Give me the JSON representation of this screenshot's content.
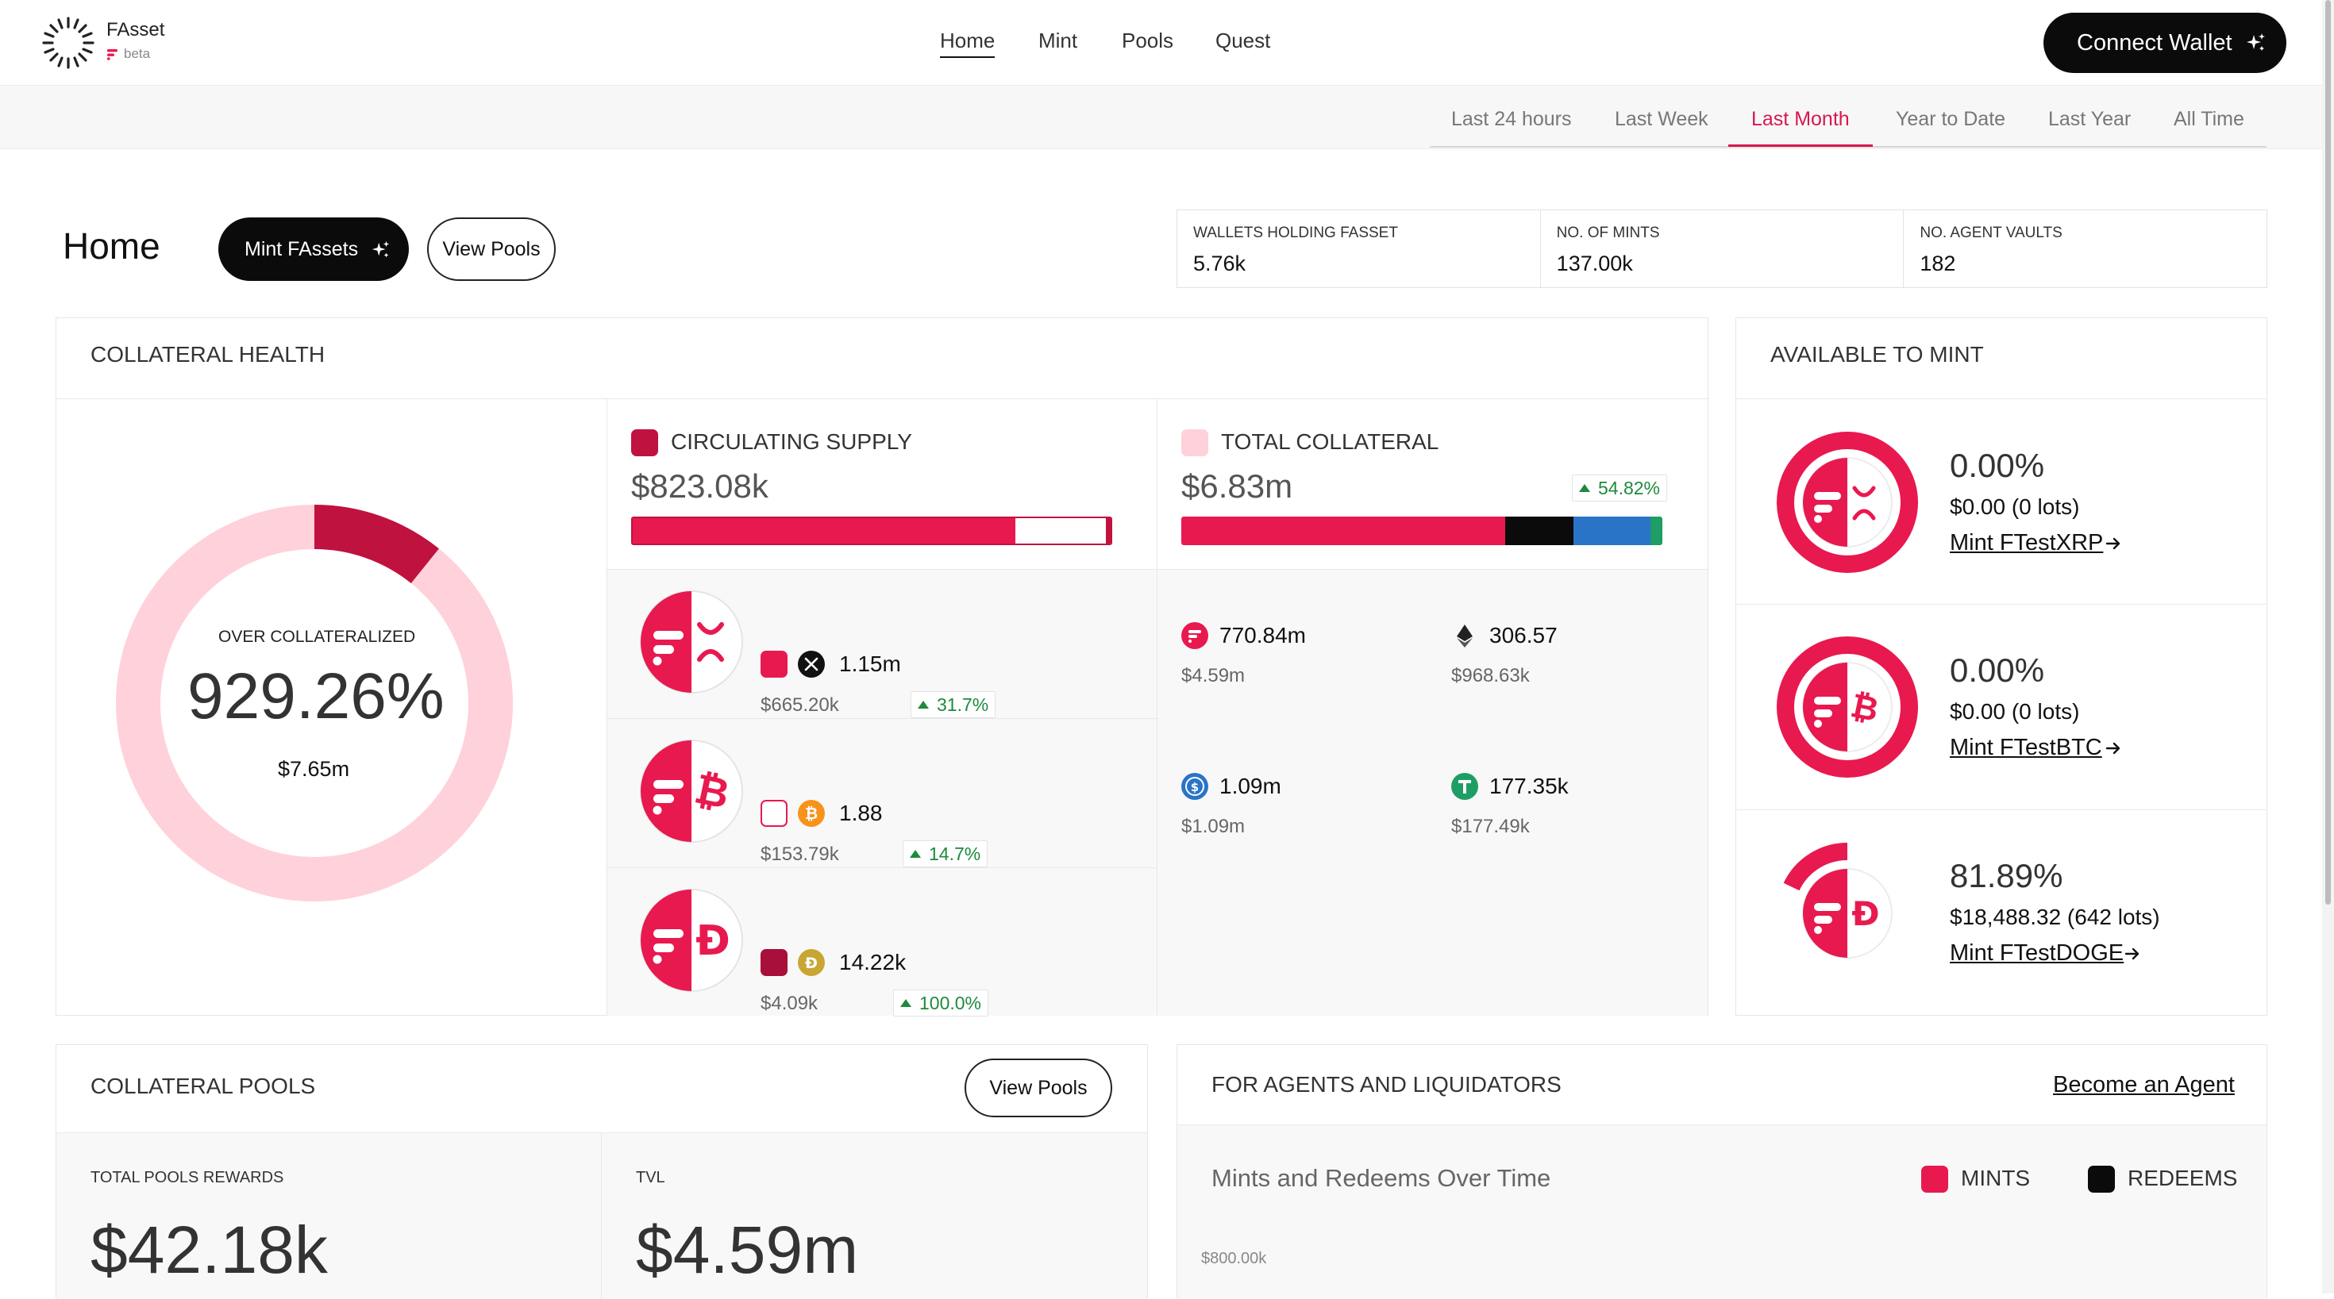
{
  "header": {
    "brand": "FAsset",
    "beta": "beta",
    "nav": [
      {
        "label": "Home",
        "active": true
      },
      {
        "label": "Mint",
        "active": false
      },
      {
        "label": "Pools",
        "active": false
      },
      {
        "label": "Quest",
        "active": false
      }
    ],
    "connect_wallet": "Connect Wallet"
  },
  "time_ranges": [
    {
      "label": "Last 24 hours",
      "active": false
    },
    {
      "label": "Last Week",
      "active": false
    },
    {
      "label": "Last Month",
      "active": true
    },
    {
      "label": "Year to Date",
      "active": false
    },
    {
      "label": "Last Year",
      "active": false
    },
    {
      "label": "All Time",
      "active": false
    }
  ],
  "home": {
    "title": "Home",
    "mint_button": "Mint FAssets",
    "view_pools_button": "View Pools",
    "stats": [
      {
        "label": "WALLETS HOLDING FASSET",
        "value": "5.76k"
      },
      {
        "label": "NO. OF MINTS",
        "value": "137.00k"
      },
      {
        "label": "NO. AGENT VAULTS",
        "value": "182"
      }
    ]
  },
  "collateral_health": {
    "title": "COLLATERAL HEALTH",
    "status": "OVER COLLATERALIZED",
    "ratio": "929.26%",
    "amount": "$7.65m",
    "ring_highlight_fraction": 0.108
  },
  "circulating_supply": {
    "title": "CIRCULATING SUPPLY",
    "value": "$823.08k",
    "bar_fill_fraction": 0.8,
    "assets": [
      {
        "icon": "xrp-icon",
        "amount": "1.15m",
        "usd": "$665.20k",
        "change": "31.7%"
      },
      {
        "icon": "btc-icon",
        "amount": "1.88",
        "usd": "$153.79k",
        "change": "14.7%"
      },
      {
        "icon": "doge-icon",
        "amount": "14.22k",
        "usd": "$4.09k",
        "change": "100.0%"
      }
    ]
  },
  "total_collateral": {
    "title": "TOTAL COLLATERAL",
    "value": "$6.83m",
    "change": "54.82%",
    "items": [
      {
        "icon": "flare-icon",
        "amount": "770.84m",
        "usd": "$4.59m"
      },
      {
        "icon": "eth-icon",
        "amount": "306.57",
        "usd": "$968.63k"
      },
      {
        "icon": "usdc-icon",
        "amount": "1.09m",
        "usd": "$1.09m"
      },
      {
        "icon": "usdt-icon",
        "amount": "177.35k",
        "usd": "$177.49k"
      }
    ],
    "colors": {
      "flare": "#e8194f",
      "eth": "#0b0b0b",
      "usdc": "#2a74c8",
      "usdt": "#1e9e64"
    }
  },
  "available_to_mint": {
    "title": "AVAILABLE TO MINT",
    "items": [
      {
        "percent": "0.00%",
        "amount": "$0.00 (0 lots)",
        "link": "Mint FTestXRP",
        "fraction": 0.0
      },
      {
        "percent": "0.00%",
        "amount": "$0.00 (0 lots)",
        "link": "Mint FTestBTC",
        "fraction": 0.0
      },
      {
        "percent": "81.89%",
        "amount": "$18,488.32 (642 lots)",
        "link": "Mint FTestDOGE",
        "fraction": 0.8189
      }
    ]
  },
  "collateral_pools": {
    "title": "COLLATERAL POOLS",
    "view_pools": "View Pools",
    "rewards_label": "TOTAL POOLS REWARDS",
    "rewards_value": "$42.18k",
    "tvl_label": "TVL",
    "tvl_value": "$4.59m"
  },
  "agents": {
    "title": "FOR AGENTS AND LIQUIDATORS",
    "become_agent": "Become an Agent",
    "chart_title": "Mints and Redeems Over Time",
    "legend_mints": "MINTS",
    "legend_redeems": "REDEEMS",
    "y_tick": "$800.00k"
  },
  "colors": {
    "accent": "#e8194f",
    "accent_dark": "#c0123f",
    "pink_light": "#ffd1da",
    "up_green": "#1e8a3c"
  }
}
